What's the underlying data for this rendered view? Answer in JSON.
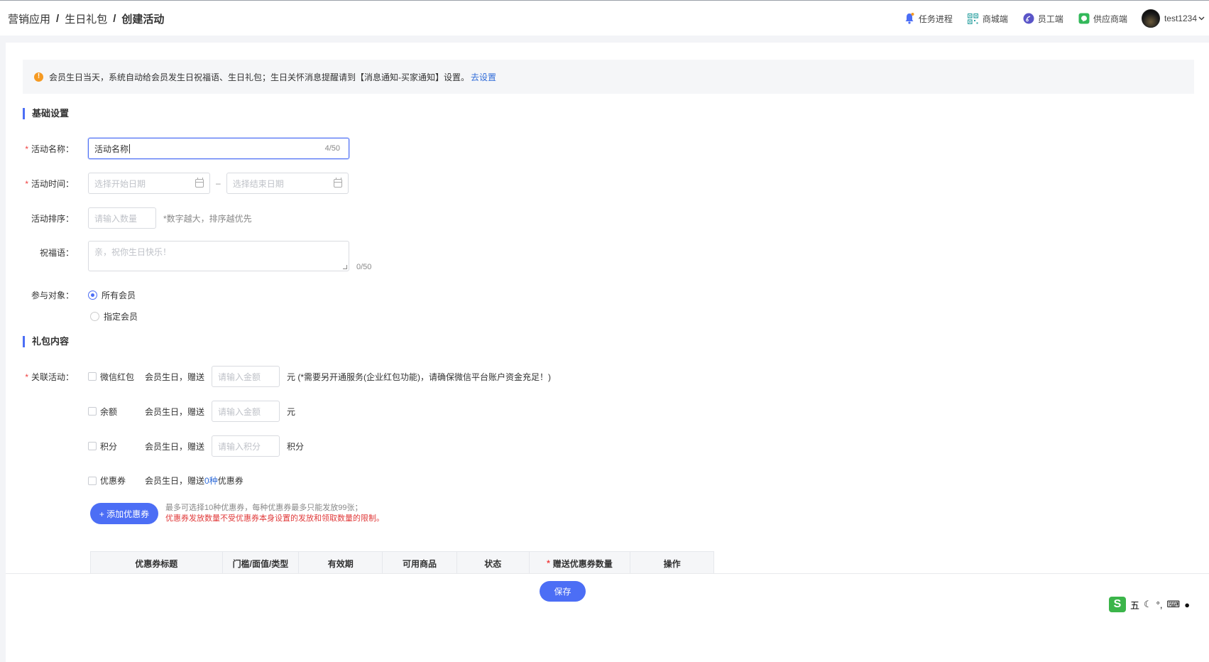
{
  "breadcrumb": [
    "营销应用",
    "生日礼包",
    "创建活动"
  ],
  "topnav": {
    "items": [
      {
        "label": "任务进程",
        "icon": "bell-icon"
      },
      {
        "label": "商城端",
        "icon": "qrcode-icon"
      },
      {
        "label": "员工端",
        "icon": "employee-app-icon"
      },
      {
        "label": "供应商端",
        "icon": "supplier-app-icon"
      }
    ],
    "username": "test1234"
  },
  "notice": {
    "text": "会员生日当天，系统自动给会员发生日祝福语、生日礼包；生日关怀消息提醒请到【消息通知-买家通知】设置。",
    "link": "去设置"
  },
  "basic": {
    "title": "基础设置",
    "name_label": "活动名称：",
    "name_value": "活动名称",
    "name_count": "4/50",
    "time_label": "活动时间：",
    "start_placeholder": "选择开始日期",
    "end_placeholder": "选择结束日期",
    "time_sep": "–",
    "sort_label": "活动排序：",
    "sort_placeholder": "请输入数量",
    "sort_hint": "*数字越大，排序越优先",
    "greet_label": "祝福语：",
    "greet_placeholder": "亲，祝你生日快乐！",
    "greet_count": "0/50",
    "target_label": "参与对象：",
    "target_all": "所有会员",
    "target_specific": "指定会员"
  },
  "gift": {
    "title": "礼包内容",
    "link_label": "关联活动：",
    "prefix": "会员生日，赠送",
    "items": [
      {
        "name": "微信红包",
        "placeholder": "请输入金额",
        "unit": "元 (*需要另开通服务(企业红包功能)，请确保微信平台账户资金充足！)"
      },
      {
        "name": "余额",
        "placeholder": "请输入金额",
        "unit": "元"
      },
      {
        "name": "积分",
        "placeholder": "请输入积分",
        "unit": "积分"
      }
    ],
    "coupon_name": "优惠券",
    "coupon_count": "0种",
    "coupon_suffix": "优惠券",
    "add_coupon": "+ 添加优惠券",
    "coupon_hint1": "最多可选择10种优惠券，每种优惠券最多只能发放99张；",
    "coupon_hint2": "优惠券发放数量不受优惠券本身设置的发放和领取数量的限制。"
  },
  "table": {
    "headers": [
      "优惠券标题",
      "门槛/面值/类型",
      "有效期",
      "可用商品",
      "状态",
      "赠送优惠券数量",
      "操作"
    ]
  },
  "footer": {
    "save": "保存"
  },
  "ime": {
    "mode": "五"
  },
  "colors": {
    "primary": "#4c6ef5",
    "warning": "#f59a23",
    "required": "#f04040",
    "link": "#2f6bd8"
  }
}
